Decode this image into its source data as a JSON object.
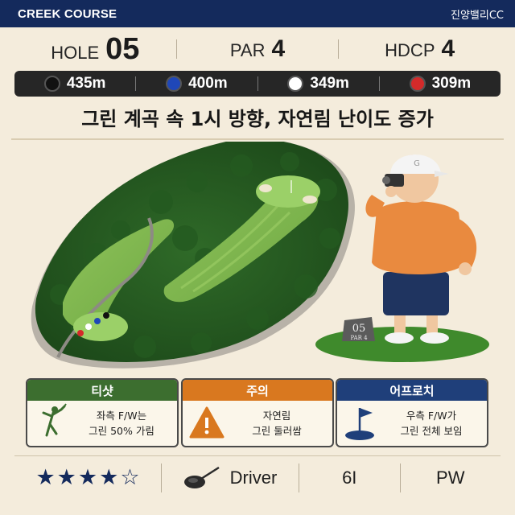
{
  "header": {
    "course": "CREEK COURSE",
    "club": "진양밸리CC"
  },
  "info": {
    "hole_label": "HOLE",
    "hole_value": "05",
    "par_label": "PAR",
    "par_value": "4",
    "hdcp_label": "HDCP",
    "hdcp_value": "4"
  },
  "tees": [
    {
      "color": "#111111",
      "distance": "435m"
    },
    {
      "color": "#1f47b8",
      "distance": "400m"
    },
    {
      "color": "#ffffff",
      "distance": "349m"
    },
    {
      "color": "#d42a2a",
      "distance": "309m"
    }
  ],
  "headline": "그린 계곡 속 1시 방향, 자연림 난이도 증가",
  "illustration": {
    "sign_hole": "05",
    "sign_par": "PAR 4",
    "cap_letter": "G"
  },
  "cards": [
    {
      "title": "티샷",
      "color": "#3c6e2f",
      "icon": "golfer-swing-icon",
      "line1": "좌측 F/W는",
      "line2": "그린 50% 가림"
    },
    {
      "title": "주의",
      "color": "#d9781f",
      "icon": "warning-icon",
      "line1": "자연림",
      "line2": "그린 둘러쌈"
    },
    {
      "title": "어프로치",
      "color": "#1f3f7a",
      "icon": "flag-icon",
      "line1": "우측 F/W가",
      "line2": "그린 전체 보임"
    }
  ],
  "bottom": {
    "difficulty_stars": 4,
    "difficulty_max": 5,
    "star_filled": "★",
    "star_empty": "☆",
    "club1": "Driver",
    "club2": "6I",
    "club3": "PW"
  }
}
